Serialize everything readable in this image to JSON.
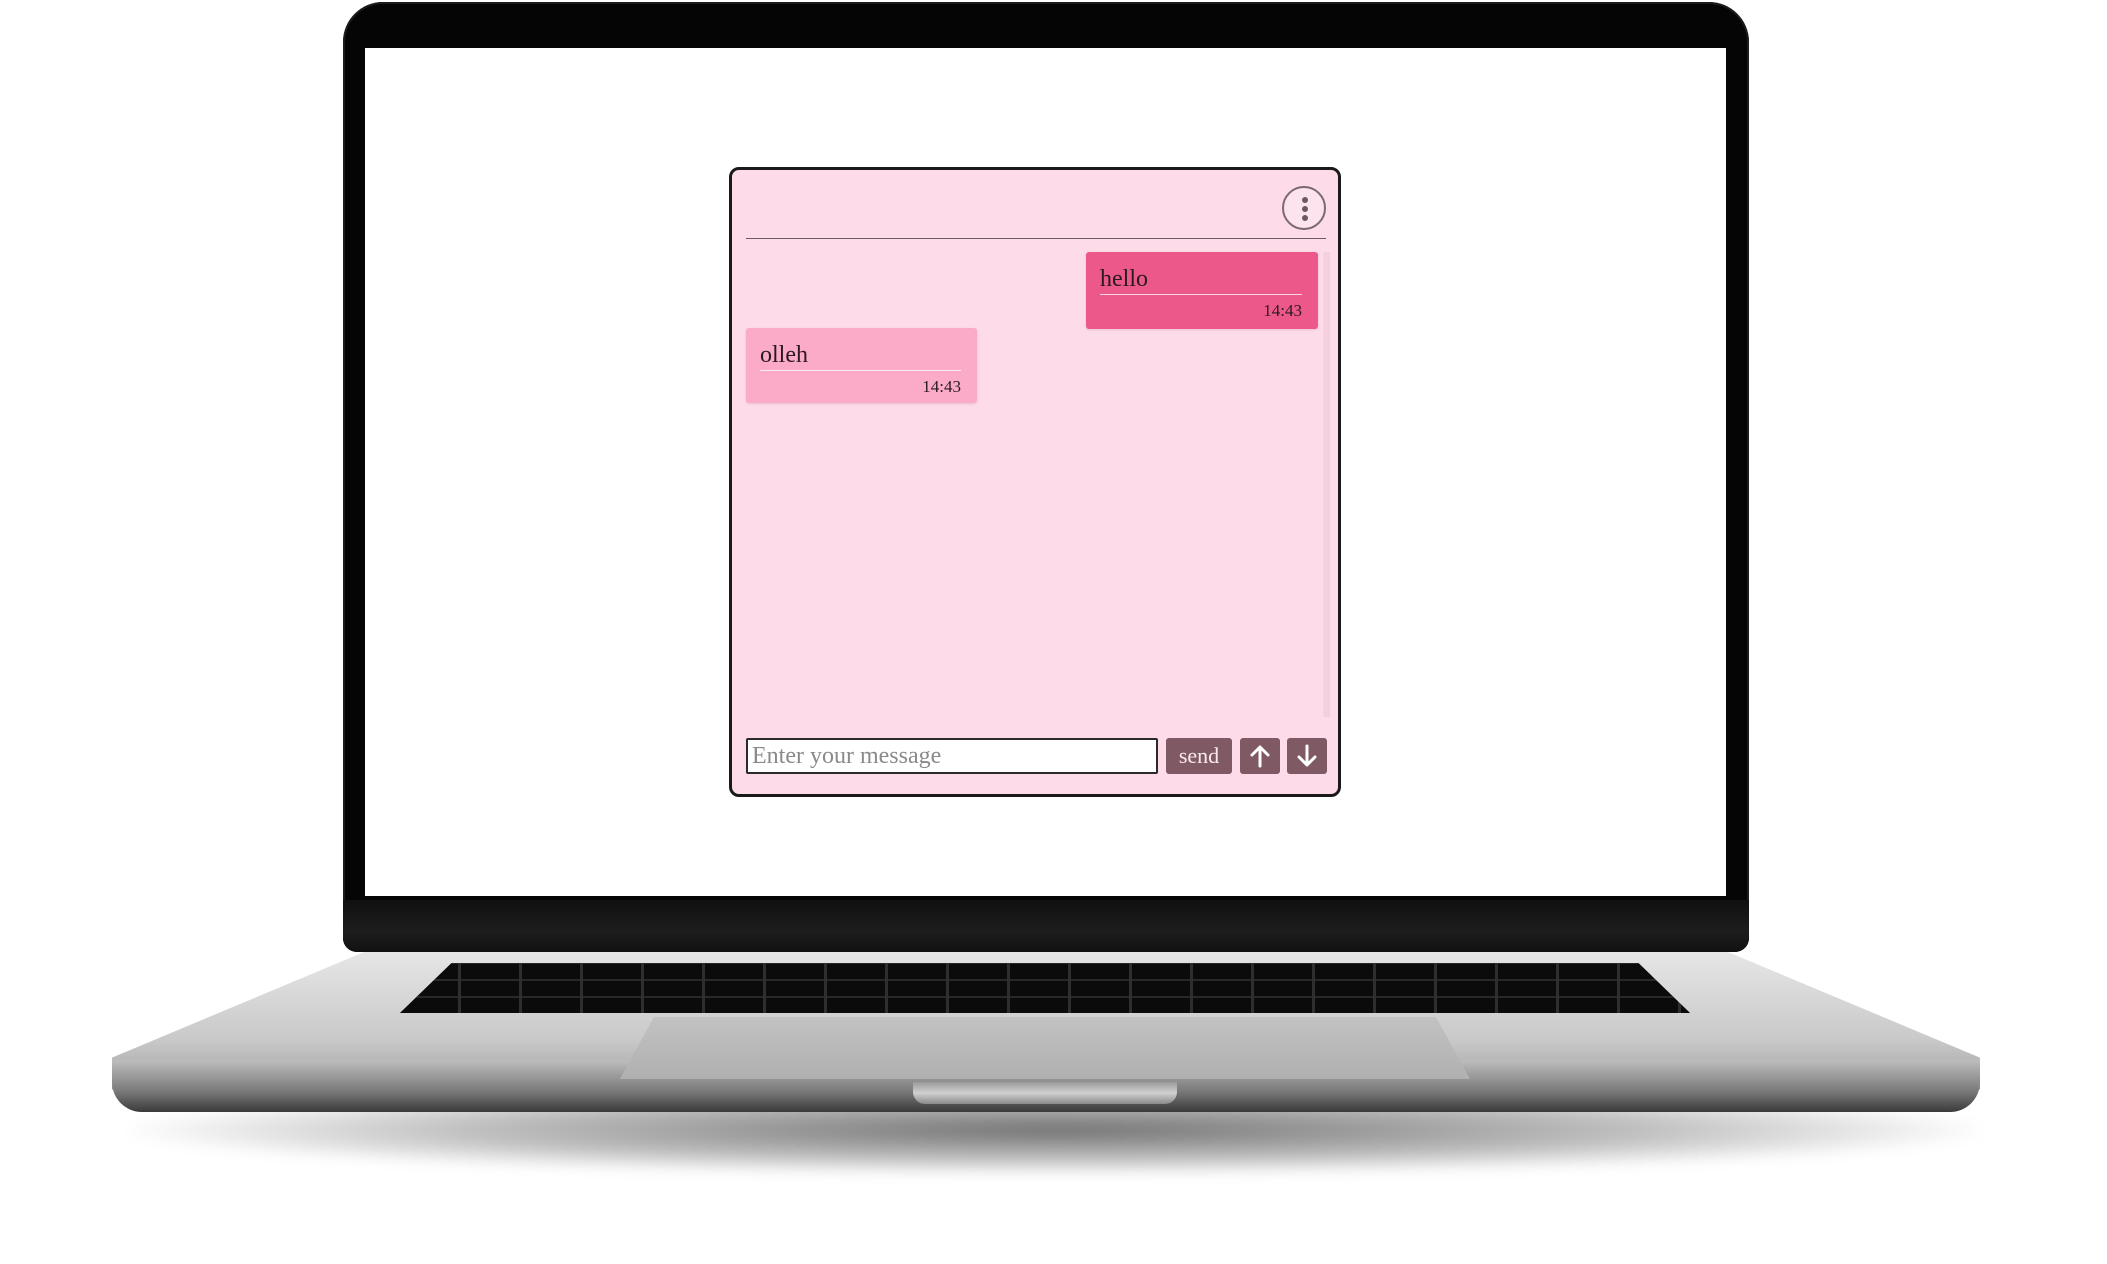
{
  "chat": {
    "menu_icon": "vertical-dots-icon",
    "messages": [
      {
        "direction": "sent",
        "text": "hello",
        "time": "14:43"
      },
      {
        "direction": "received",
        "text": "olleh",
        "time": "14:43"
      }
    ],
    "input": {
      "placeholder": "Enter your message",
      "value": ""
    },
    "send_label": "send",
    "scroll_up_icon": "arrow-up-icon",
    "scroll_down_icon": "arrow-down-icon"
  },
  "colors": {
    "chat_background": "#fddbe8",
    "sent_bubble": "#ec5889",
    "received_bubble": "#fbaac8",
    "button": "#7f5a64"
  }
}
